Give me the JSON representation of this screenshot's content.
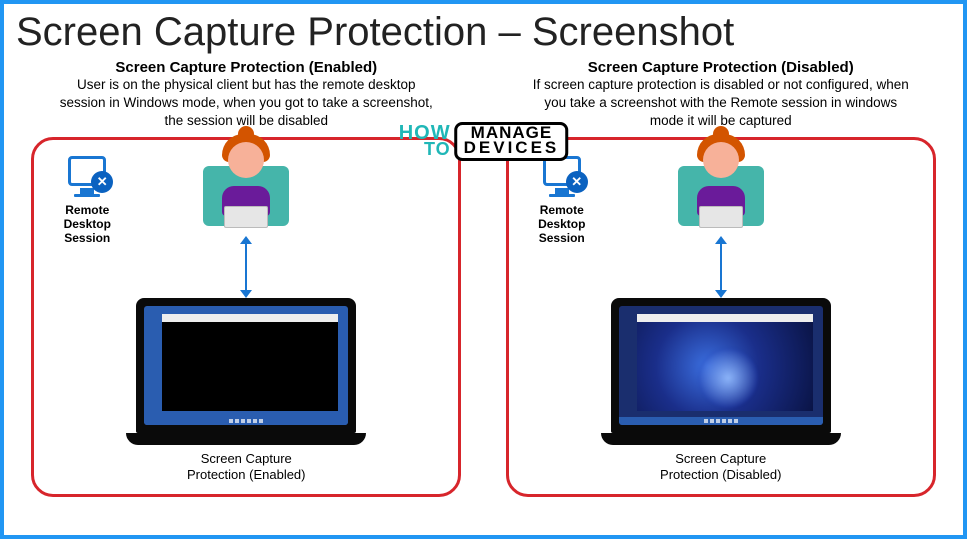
{
  "title": "Screen Capture Protection – Screenshot",
  "watermark": {
    "how": "HOW",
    "to": "TO",
    "manage": "MANAGE",
    "devices": "DEVICES"
  },
  "rds_label_l1": "Remote",
  "rds_label_l2": "Desktop",
  "rds_label_l3": "Session",
  "left": {
    "heading": "Screen Capture Protection (Enabled)",
    "desc": "User is on the physical client but has the remote desktop session in Windows mode, when you got to take a screenshot, the session will be disabled",
    "laptop_caption_l1": "Screen Capture",
    "laptop_caption_l2": "Protection (Enabled)"
  },
  "right": {
    "heading": "Screen Capture Protection (Disabled)",
    "desc": "If screen capture protection is disabled or not configured, when you take a screenshot with the Remote session in windows mode it will be captured",
    "laptop_caption_l1": "Screen Capture",
    "laptop_caption_l2": "Protection (Disabled)"
  }
}
